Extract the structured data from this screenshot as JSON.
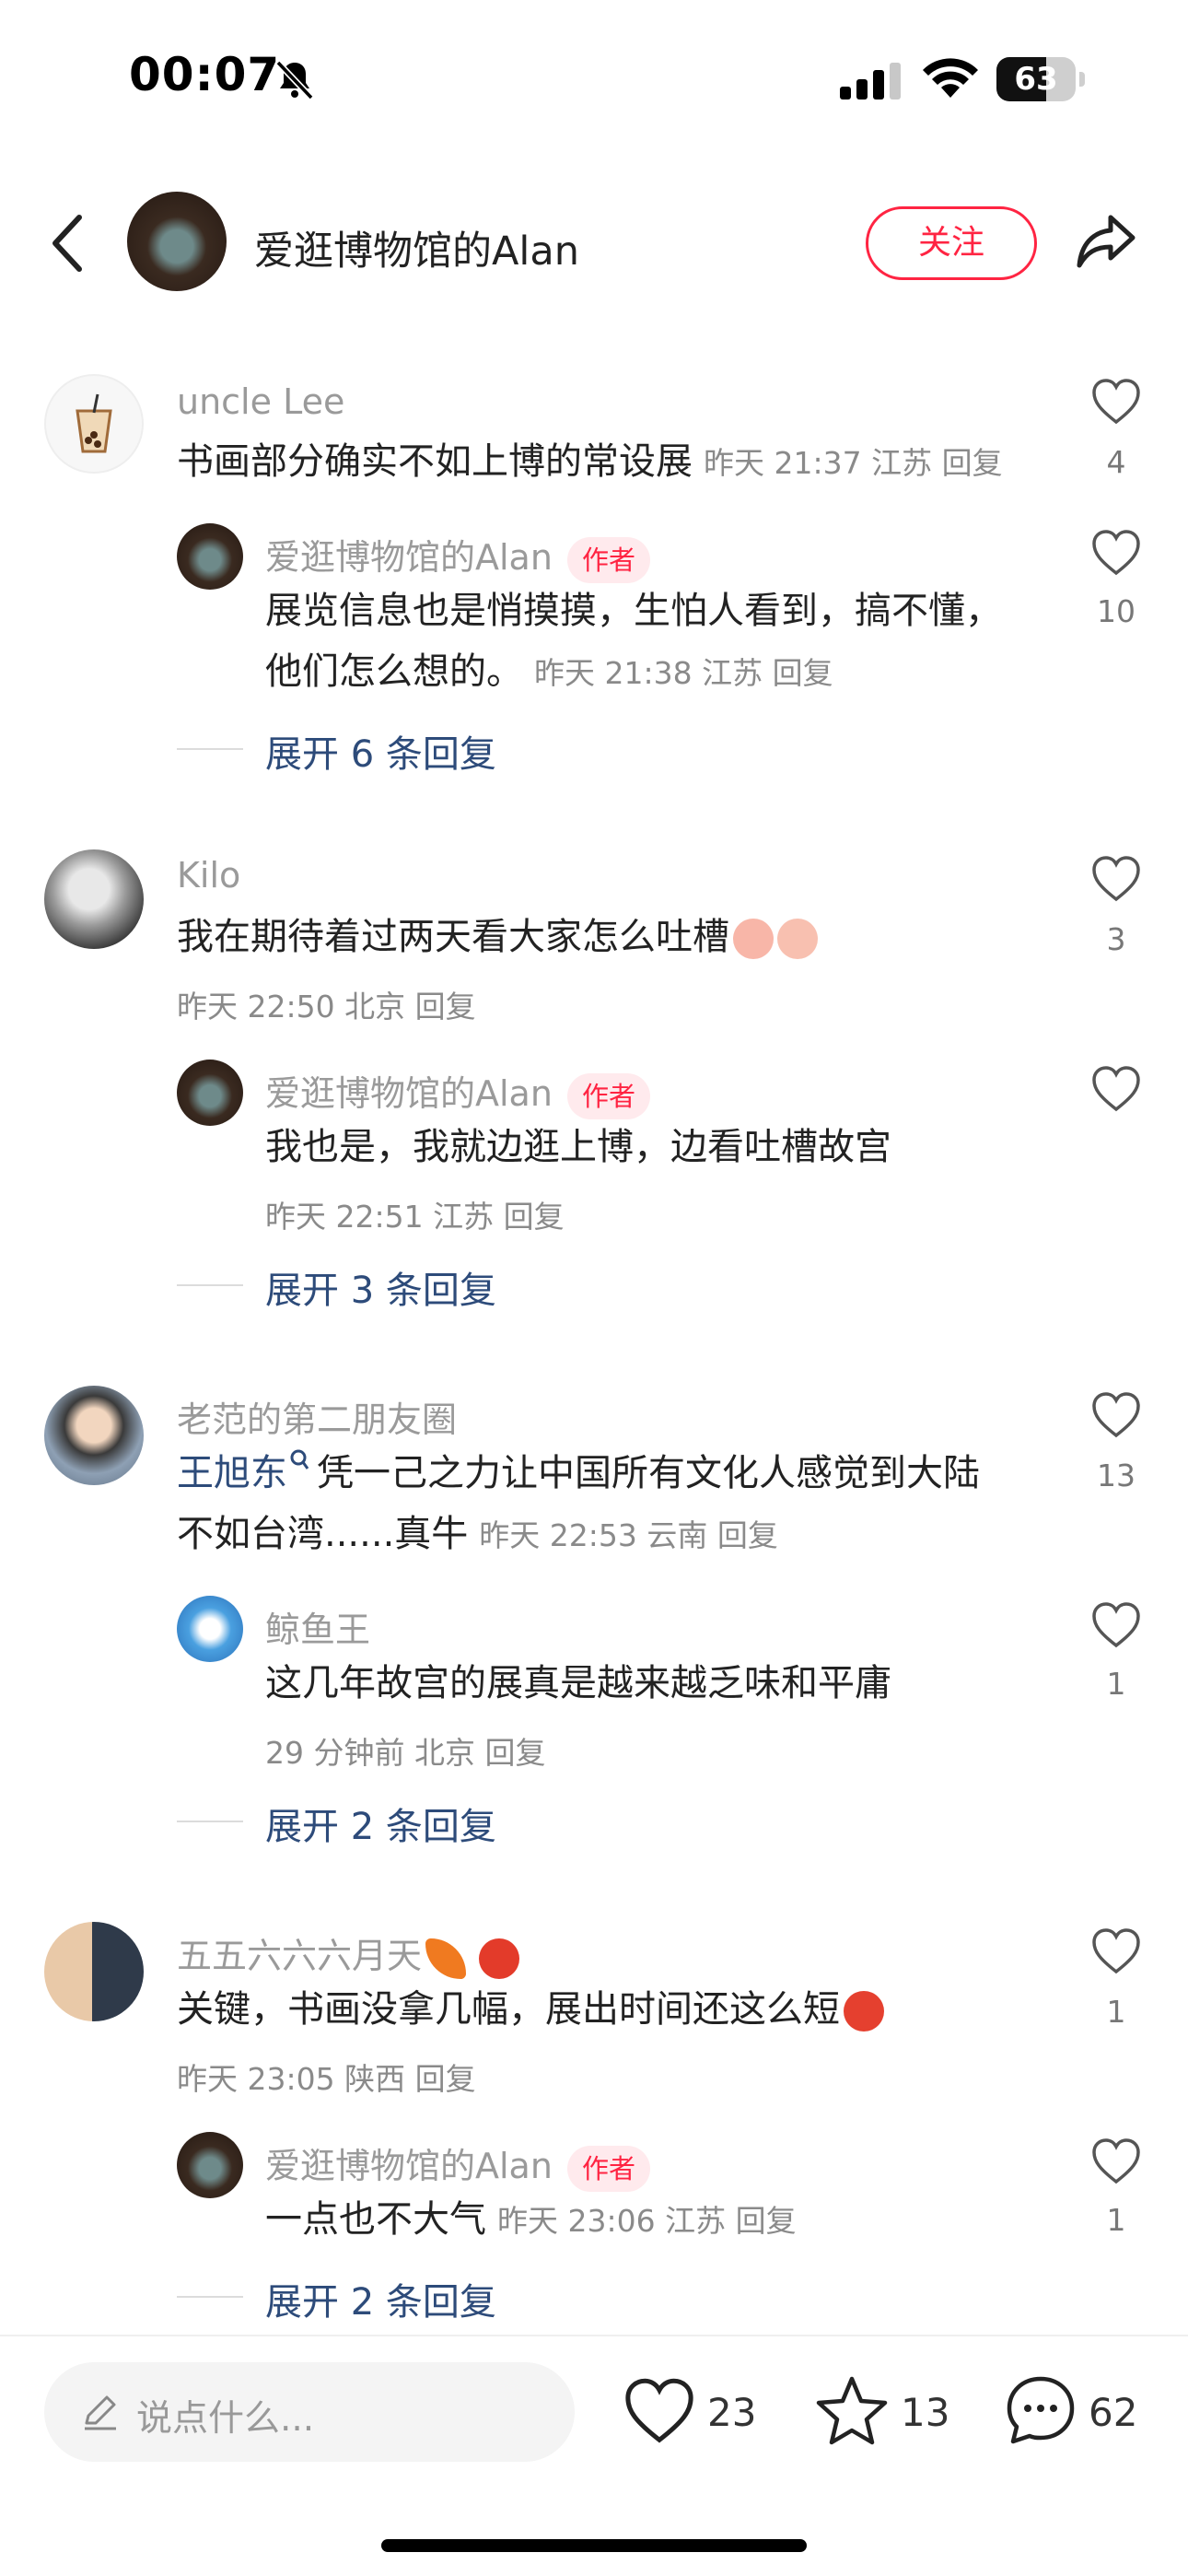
{
  "status_bar": {
    "time": "00:07",
    "battery": "63",
    "battery_level": 0.63
  },
  "header": {
    "author": "爱逛博物馆的Alan",
    "follow_label": "关注"
  },
  "comments": [
    {
      "user": "uncle Lee",
      "text": "书画部分确实不如上博的常设展",
      "meta": "昨天 21:37 江苏 回复",
      "likes": "4",
      "reply": {
        "user": "爱逛博物馆的Alan",
        "tag": "作者",
        "line1": "展览信息也是悄摸摸，生怕人看到，搞不懂，",
        "line2": "他们怎么想的。",
        "meta": "昨天 21:38 江苏 回复",
        "likes": "10"
      },
      "expand": "展开 6 条回复"
    },
    {
      "user": "Kilo",
      "text": "我在期待着过两天看大家怎么吐槽",
      "meta": "昨天 22:50 北京 回复",
      "likes": "3",
      "reply": {
        "user": "爱逛博物馆的Alan",
        "tag": "作者",
        "line1": "我也是，我就边逛上博，边看吐槽故宫",
        "meta": "昨天 22:51 江苏 回复",
        "likes": ""
      },
      "expand": "展开 3 条回复"
    },
    {
      "user": "老范的第二朋友圈",
      "mention": "王旭东",
      "line1": "凭一己之力让中国所有文化人感觉到大陆",
      "line2": "不如台湾......真牛",
      "meta": "昨天 22:53 云南 回复",
      "likes": "13",
      "reply": {
        "user": "鲸鱼王",
        "line1": "这几年故宫的展真是越来越乏味和平庸",
        "meta": "29 分钟前 北京 回复",
        "likes": "1"
      },
      "expand": "展开 2 条回复"
    },
    {
      "user": "五五六六六月天",
      "text": "关键，书画没拿几幅，展出时间还这么短",
      "meta": "昨天 23:05 陕西 回复",
      "likes": "1",
      "reply": {
        "user": "爱逛博物馆的Alan",
        "tag": "作者",
        "line1": "一点也不大气",
        "meta": "昨天 23:06 江苏 回复",
        "likes": "1"
      },
      "expand": "展开 2 条回复"
    }
  ],
  "bottom_bar": {
    "input_placeholder": "说点什么...",
    "likes": "23",
    "favorites": "13",
    "comments": "62"
  },
  "colors": {
    "accent": "#ff2442",
    "link": "#2d4b7a",
    "muted": "#9a9a9a"
  },
  "icons": [
    "bell-slash-icon",
    "signal-icon",
    "wifi-icon",
    "battery-icon",
    "back-icon",
    "share-icon",
    "heart-icon",
    "star-icon",
    "comment-icon",
    "pencil-icon"
  ]
}
